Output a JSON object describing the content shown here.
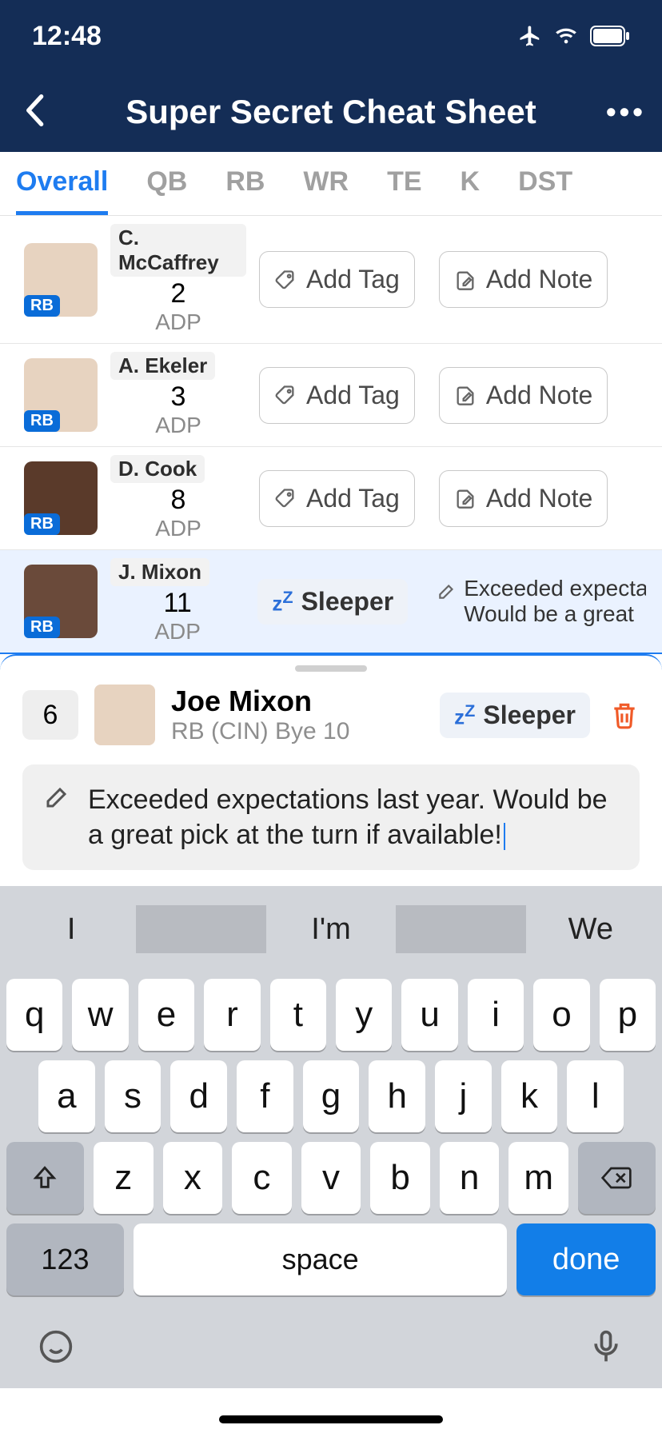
{
  "status": {
    "time": "12:48"
  },
  "header": {
    "title": "Super Secret Cheat Sheet"
  },
  "tabs": [
    "Overall",
    "QB",
    "RB",
    "WR",
    "TE",
    "K",
    "DST"
  ],
  "active_tab": "Overall",
  "adp_label": "ADP",
  "add_tag_label": "Add Tag",
  "add_note_label": "Add Note",
  "players": [
    {
      "name": "C. McCaffrey",
      "pos": "RB",
      "adp": "2"
    },
    {
      "name": "A. Ekeler",
      "pos": "RB",
      "adp": "3"
    },
    {
      "name": "D. Cook",
      "pos": "RB",
      "adp": "8"
    },
    {
      "name": "J. Mixon",
      "pos": "RB",
      "adp": "11",
      "tag": "Sleeper",
      "note_line1": "Exceeded expecta",
      "note_line2": "Would be a great "
    }
  ],
  "detail": {
    "rank": "6",
    "name": "Joe Mixon",
    "subtitle": "RB (CIN) Bye 10",
    "tag": "Sleeper",
    "note": "Exceeded expectations last year. Would be a great pick at the turn if available!"
  },
  "keyboard": {
    "suggestions": [
      "I",
      "I'm",
      "We"
    ],
    "row1": [
      "q",
      "w",
      "e",
      "r",
      "t",
      "y",
      "u",
      "i",
      "o",
      "p"
    ],
    "row2": [
      "a",
      "s",
      "d",
      "f",
      "g",
      "h",
      "j",
      "k",
      "l"
    ],
    "row3": [
      "z",
      "x",
      "c",
      "v",
      "b",
      "n",
      "m"
    ],
    "num_key": "123",
    "space_key": "space",
    "done_key": "done"
  }
}
